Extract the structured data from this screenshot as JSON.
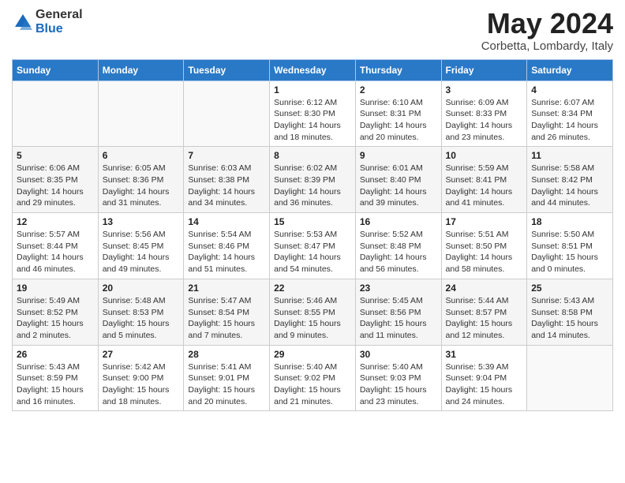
{
  "header": {
    "logo_general": "General",
    "logo_blue": "Blue",
    "title": "May 2024",
    "subtitle": "Corbetta, Lombardy, Italy"
  },
  "days_of_week": [
    "Sunday",
    "Monday",
    "Tuesday",
    "Wednesday",
    "Thursday",
    "Friday",
    "Saturday"
  ],
  "weeks": [
    [
      {
        "day": "",
        "info": ""
      },
      {
        "day": "",
        "info": ""
      },
      {
        "day": "",
        "info": ""
      },
      {
        "day": "1",
        "info": "Sunrise: 6:12 AM\nSunset: 8:30 PM\nDaylight: 14 hours and 18 minutes."
      },
      {
        "day": "2",
        "info": "Sunrise: 6:10 AM\nSunset: 8:31 PM\nDaylight: 14 hours and 20 minutes."
      },
      {
        "day": "3",
        "info": "Sunrise: 6:09 AM\nSunset: 8:33 PM\nDaylight: 14 hours and 23 minutes."
      },
      {
        "day": "4",
        "info": "Sunrise: 6:07 AM\nSunset: 8:34 PM\nDaylight: 14 hours and 26 minutes."
      }
    ],
    [
      {
        "day": "5",
        "info": "Sunrise: 6:06 AM\nSunset: 8:35 PM\nDaylight: 14 hours and 29 minutes."
      },
      {
        "day": "6",
        "info": "Sunrise: 6:05 AM\nSunset: 8:36 PM\nDaylight: 14 hours and 31 minutes."
      },
      {
        "day": "7",
        "info": "Sunrise: 6:03 AM\nSunset: 8:38 PM\nDaylight: 14 hours and 34 minutes."
      },
      {
        "day": "8",
        "info": "Sunrise: 6:02 AM\nSunset: 8:39 PM\nDaylight: 14 hours and 36 minutes."
      },
      {
        "day": "9",
        "info": "Sunrise: 6:01 AM\nSunset: 8:40 PM\nDaylight: 14 hours and 39 minutes."
      },
      {
        "day": "10",
        "info": "Sunrise: 5:59 AM\nSunset: 8:41 PM\nDaylight: 14 hours and 41 minutes."
      },
      {
        "day": "11",
        "info": "Sunrise: 5:58 AM\nSunset: 8:42 PM\nDaylight: 14 hours and 44 minutes."
      }
    ],
    [
      {
        "day": "12",
        "info": "Sunrise: 5:57 AM\nSunset: 8:44 PM\nDaylight: 14 hours and 46 minutes."
      },
      {
        "day": "13",
        "info": "Sunrise: 5:56 AM\nSunset: 8:45 PM\nDaylight: 14 hours and 49 minutes."
      },
      {
        "day": "14",
        "info": "Sunrise: 5:54 AM\nSunset: 8:46 PM\nDaylight: 14 hours and 51 minutes."
      },
      {
        "day": "15",
        "info": "Sunrise: 5:53 AM\nSunset: 8:47 PM\nDaylight: 14 hours and 54 minutes."
      },
      {
        "day": "16",
        "info": "Sunrise: 5:52 AM\nSunset: 8:48 PM\nDaylight: 14 hours and 56 minutes."
      },
      {
        "day": "17",
        "info": "Sunrise: 5:51 AM\nSunset: 8:50 PM\nDaylight: 14 hours and 58 minutes."
      },
      {
        "day": "18",
        "info": "Sunrise: 5:50 AM\nSunset: 8:51 PM\nDaylight: 15 hours and 0 minutes."
      }
    ],
    [
      {
        "day": "19",
        "info": "Sunrise: 5:49 AM\nSunset: 8:52 PM\nDaylight: 15 hours and 2 minutes."
      },
      {
        "day": "20",
        "info": "Sunrise: 5:48 AM\nSunset: 8:53 PM\nDaylight: 15 hours and 5 minutes."
      },
      {
        "day": "21",
        "info": "Sunrise: 5:47 AM\nSunset: 8:54 PM\nDaylight: 15 hours and 7 minutes."
      },
      {
        "day": "22",
        "info": "Sunrise: 5:46 AM\nSunset: 8:55 PM\nDaylight: 15 hours and 9 minutes."
      },
      {
        "day": "23",
        "info": "Sunrise: 5:45 AM\nSunset: 8:56 PM\nDaylight: 15 hours and 11 minutes."
      },
      {
        "day": "24",
        "info": "Sunrise: 5:44 AM\nSunset: 8:57 PM\nDaylight: 15 hours and 12 minutes."
      },
      {
        "day": "25",
        "info": "Sunrise: 5:43 AM\nSunset: 8:58 PM\nDaylight: 15 hours and 14 minutes."
      }
    ],
    [
      {
        "day": "26",
        "info": "Sunrise: 5:43 AM\nSunset: 8:59 PM\nDaylight: 15 hours and 16 minutes."
      },
      {
        "day": "27",
        "info": "Sunrise: 5:42 AM\nSunset: 9:00 PM\nDaylight: 15 hours and 18 minutes."
      },
      {
        "day": "28",
        "info": "Sunrise: 5:41 AM\nSunset: 9:01 PM\nDaylight: 15 hours and 20 minutes."
      },
      {
        "day": "29",
        "info": "Sunrise: 5:40 AM\nSunset: 9:02 PM\nDaylight: 15 hours and 21 minutes."
      },
      {
        "day": "30",
        "info": "Sunrise: 5:40 AM\nSunset: 9:03 PM\nDaylight: 15 hours and 23 minutes."
      },
      {
        "day": "31",
        "info": "Sunrise: 5:39 AM\nSunset: 9:04 PM\nDaylight: 15 hours and 24 minutes."
      },
      {
        "day": "",
        "info": ""
      }
    ]
  ]
}
